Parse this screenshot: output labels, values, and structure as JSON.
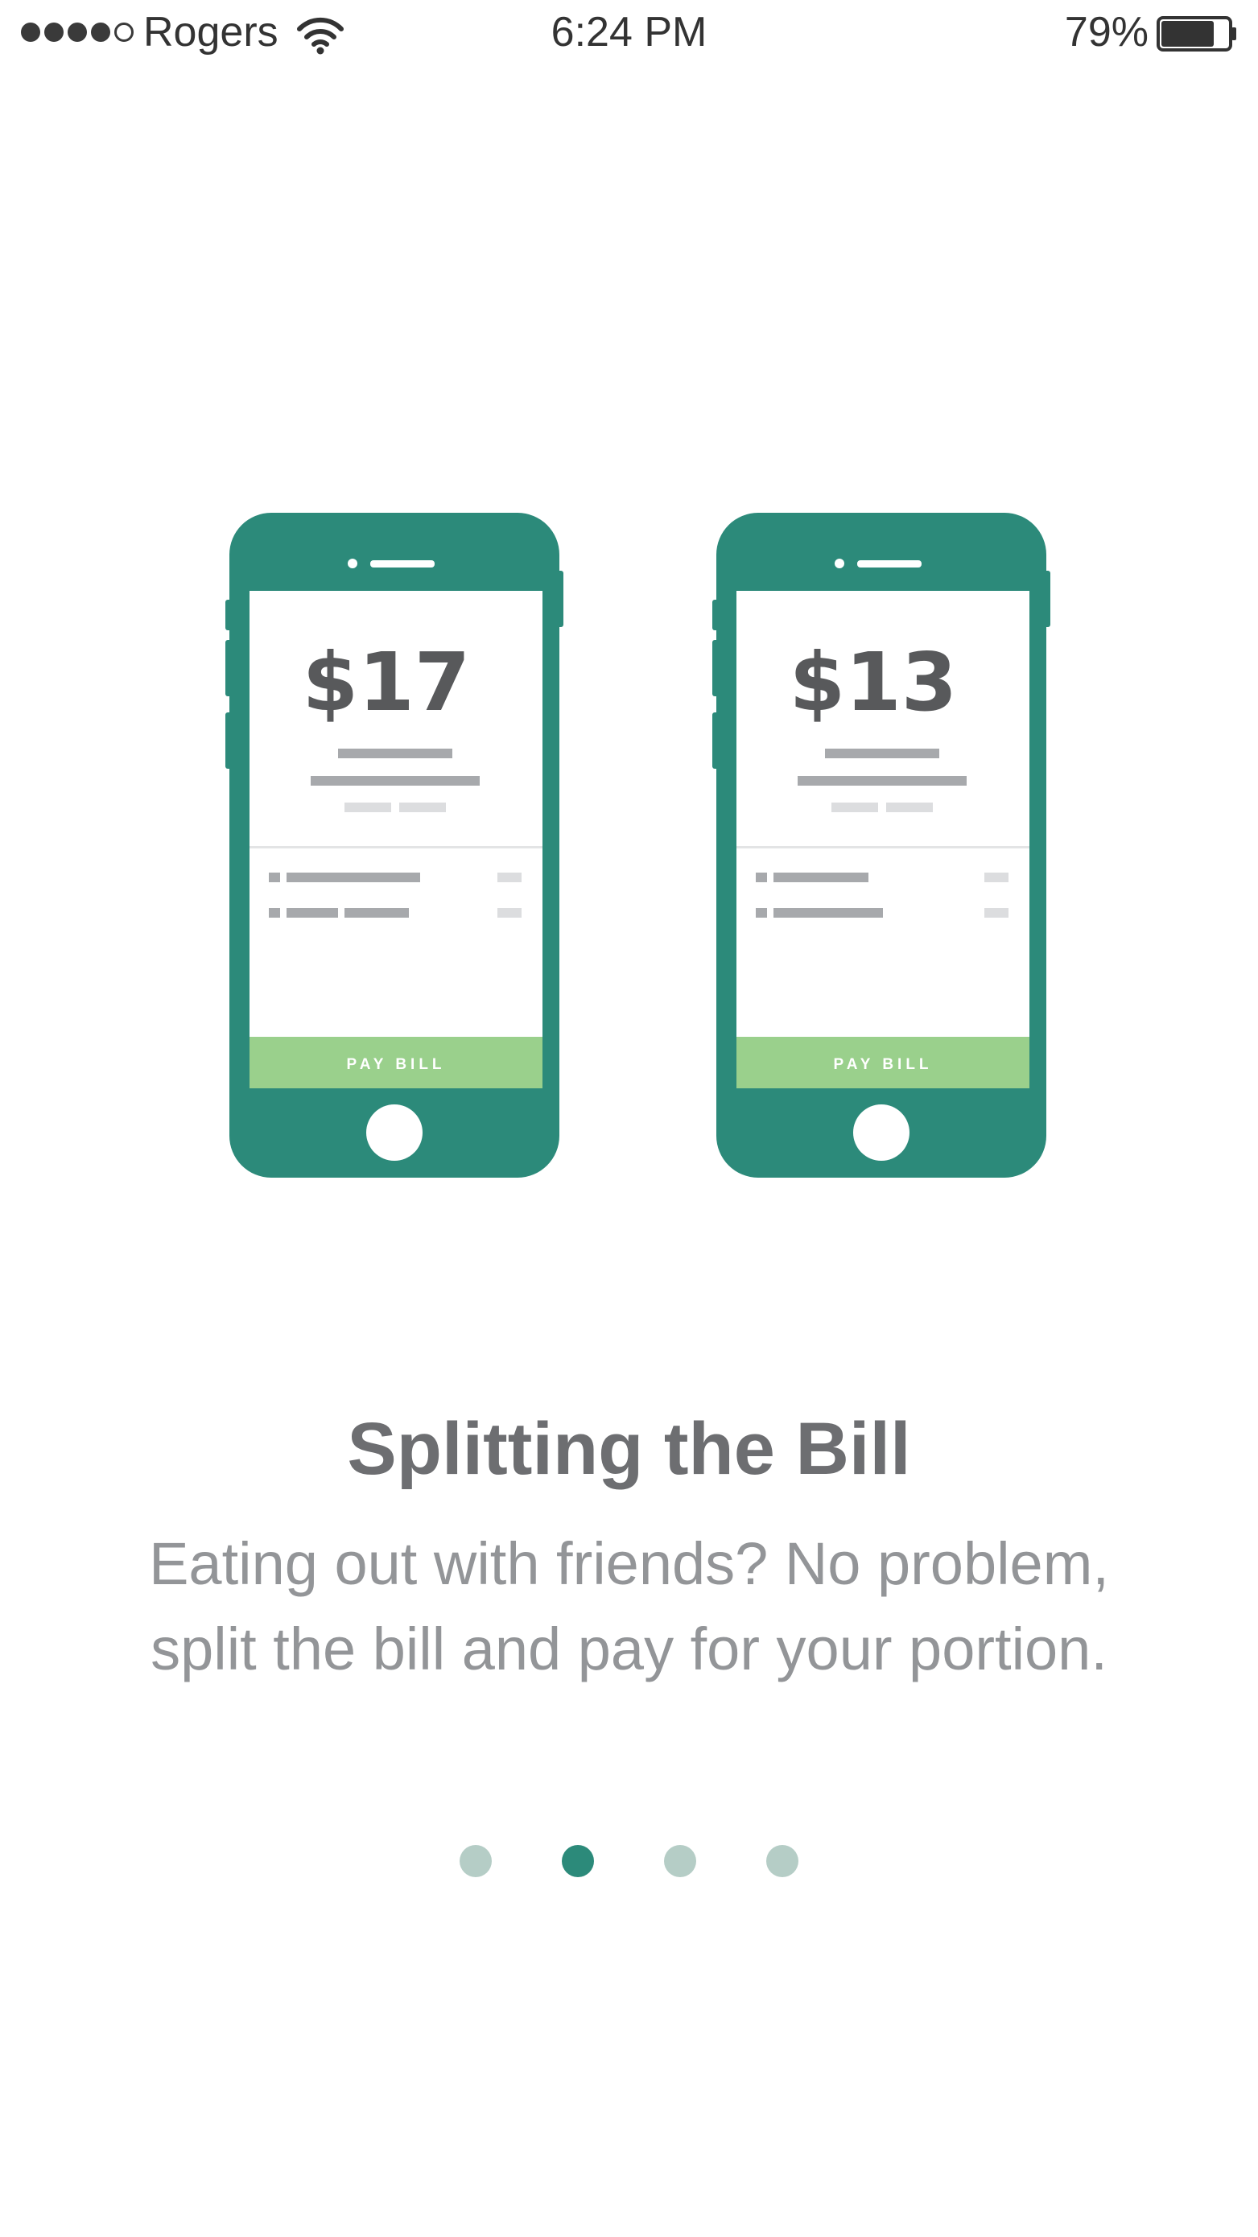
{
  "status_bar": {
    "carrier": "Rogers",
    "time": "6:24 PM",
    "battery_percent": "79%",
    "signal_bars_filled": 4,
    "signal_bars_total": 5,
    "battery_level": 0.79,
    "icons": [
      "wifi-icon",
      "battery-icon"
    ]
  },
  "illustration": {
    "phones": [
      {
        "amount": "$17",
        "button_label": "PAY BILL"
      },
      {
        "amount": "$13",
        "button_label": "PAY BILL"
      }
    ]
  },
  "onboarding": {
    "title": "Splitting the Bill",
    "description_line1": "Eating out with friends? No problem,",
    "description_line2": "split the bill and pay for your portion."
  },
  "pager": {
    "total_pages": 4,
    "current_page": 2
  },
  "colors": {
    "brand_green": "#2c8a7a",
    "pay_button_green": "#9ad08c",
    "title_gray": "#6d6e71",
    "body_gray": "#939598",
    "indicator_inactive": "#b5cdc6"
  }
}
